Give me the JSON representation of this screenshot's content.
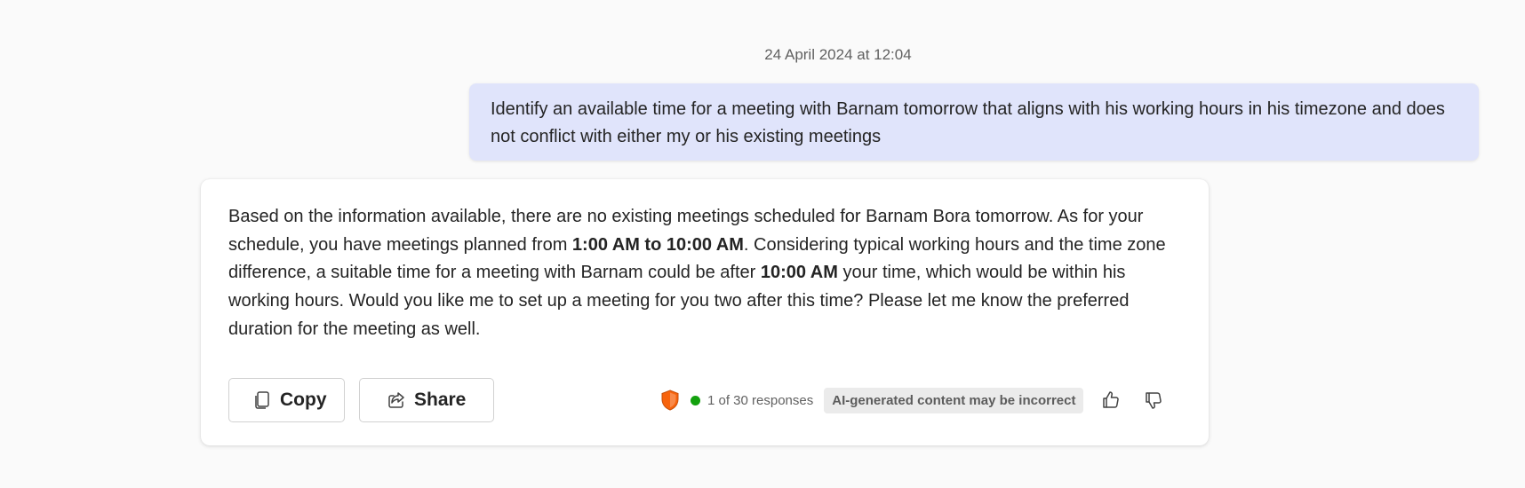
{
  "timestamp": "24 April 2024 at 12:04",
  "user_message": "Identify an available time for a meeting with Barnam tomorrow that aligns with his working hours in his timezone and does not conflict with either my or his existing meetings",
  "bot_message": {
    "part1": "Based on the information available, there are no existing meetings scheduled for Barnam Bora tomorrow. As for your schedule, you have meetings planned from ",
    "bold1": "1:00 AM to 10:00 AM",
    "part2": ". Considering typical working hours and the time zone difference, a suitable time for a meeting with Barnam could be after ",
    "bold2": "10:00 AM",
    "part3": " your time, which would be within his working hours. Would you like me to set up a meeting for you two after this time? Please let me know the preferred duration for the meeting as well."
  },
  "actions": {
    "copy_label": "Copy",
    "share_label": "Share"
  },
  "footer": {
    "responses": "1 of 30 responses",
    "disclaimer": "AI-generated content may be incorrect"
  },
  "colors": {
    "user_bubble": "#e0e4fb",
    "shield": "#f7630c",
    "status_dot": "#13a10e"
  }
}
